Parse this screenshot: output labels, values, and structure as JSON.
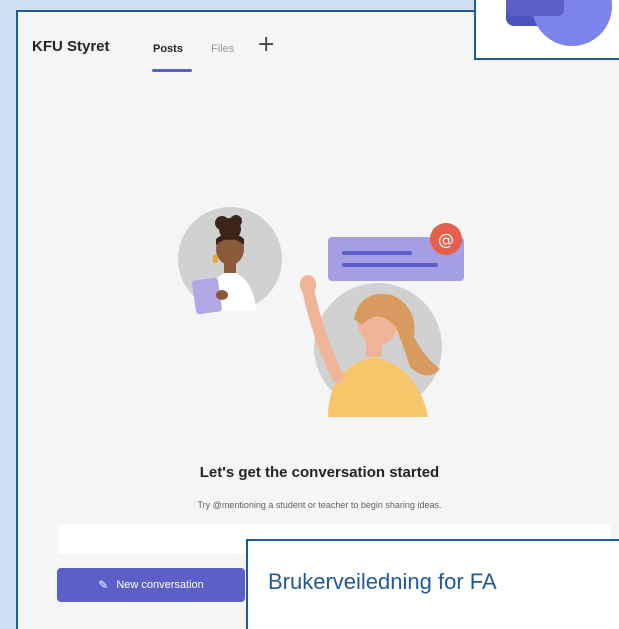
{
  "header": {
    "team_name": "KFU Styret",
    "tabs": [
      {
        "label": "Posts",
        "active": true
      },
      {
        "label": "Files",
        "active": false
      }
    ],
    "add_tab_label": "+"
  },
  "empty_state": {
    "title": "Let's get the conversation started",
    "subtitle": "Try @mentioning a student or teacher to begin sharing ideas.",
    "illustration_badge": "@"
  },
  "actions": {
    "new_conversation_label": "New conversation",
    "new_conversation_icon": "compose-icon"
  },
  "banner": {
    "text": "Brukerveiledning for FA"
  },
  "colors": {
    "accent": "#5b5fc7",
    "frame_border": "#1f5b98",
    "page_background": "#cde0f1",
    "app_background": "#f5f5f5",
    "banner_text": "#1f5b98"
  }
}
